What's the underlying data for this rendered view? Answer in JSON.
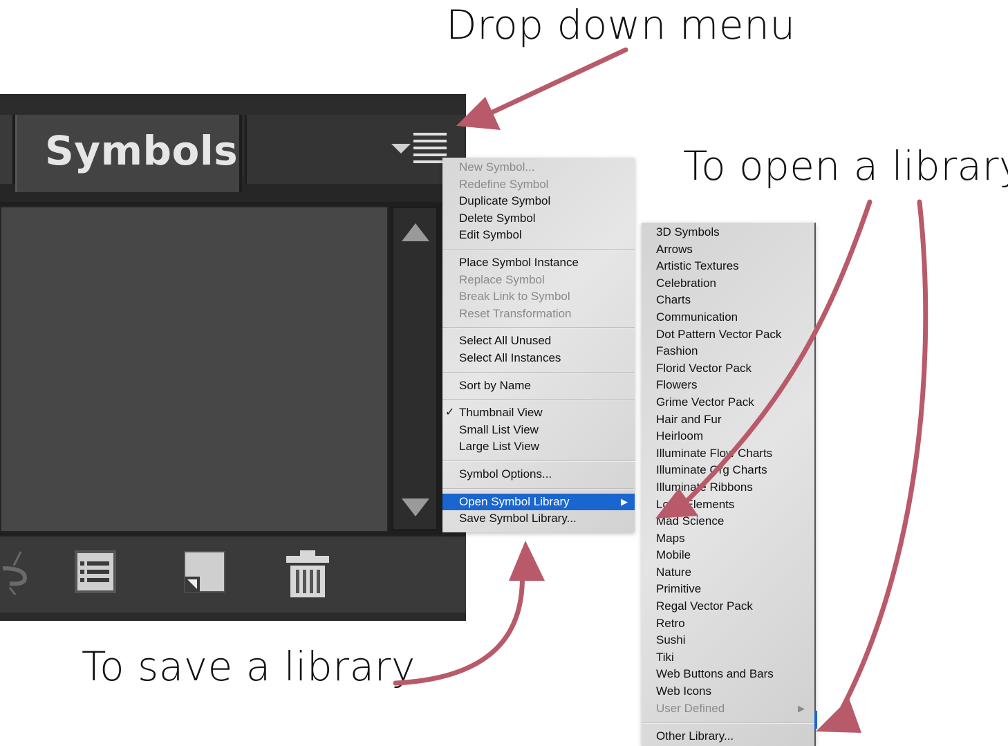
{
  "annotations": {
    "dropdown": "Drop down menu",
    "open_library": "To open a library",
    "save_library": "To save a library"
  },
  "panel": {
    "tab_title": "Symbols"
  },
  "main_menu": {
    "groups": [
      [
        {
          "label": "New Symbol...",
          "disabled": true
        },
        {
          "label": "Redefine Symbol",
          "disabled": true
        },
        {
          "label": "Duplicate Symbol",
          "disabled": false
        },
        {
          "label": "Delete Symbol",
          "disabled": false
        },
        {
          "label": "Edit Symbol",
          "disabled": false
        }
      ],
      [
        {
          "label": "Place Symbol Instance",
          "disabled": false
        },
        {
          "label": "Replace Symbol",
          "disabled": true
        },
        {
          "label": "Break Link to Symbol",
          "disabled": true
        },
        {
          "label": "Reset Transformation",
          "disabled": true
        }
      ],
      [
        {
          "label": "Select All Unused",
          "disabled": false
        },
        {
          "label": "Select All Instances",
          "disabled": false
        }
      ],
      [
        {
          "label": "Sort by Name",
          "disabled": false
        }
      ],
      [
        {
          "label": "Thumbnail View",
          "disabled": false,
          "checked": true
        },
        {
          "label": "Small List View",
          "disabled": false
        },
        {
          "label": "Large List View",
          "disabled": false
        }
      ],
      [
        {
          "label": "Symbol Options...",
          "disabled": false
        }
      ],
      [
        {
          "label": "Open Symbol Library",
          "disabled": false,
          "selected": true,
          "submenu": true
        },
        {
          "label": "Save Symbol Library...",
          "disabled": false
        }
      ]
    ]
  },
  "library_menu": {
    "items": [
      "3D Symbols",
      "Arrows",
      "Artistic Textures",
      "Celebration",
      "Charts",
      "Communication",
      "Dot Pattern Vector Pack",
      "Fashion",
      "Florid Vector Pack",
      "Flowers",
      "Grime Vector Pack",
      "Hair and Fur",
      "Heirloom",
      "Illuminate Flow Charts",
      "Illuminate Org Charts",
      "Illuminate Ribbons",
      "Logo Elements",
      "Mad Science",
      "Maps",
      "Mobile",
      "Nature",
      "Primitive",
      "Regal Vector Pack",
      "Retro",
      "Sushi",
      "Tiki",
      "Web Buttons and Bars",
      "Web Icons"
    ],
    "user_defined": "User Defined",
    "other_library": "Other Library..."
  },
  "colors": {
    "arrow": "#b85a6a",
    "menu_highlight": "#1a66d0"
  }
}
